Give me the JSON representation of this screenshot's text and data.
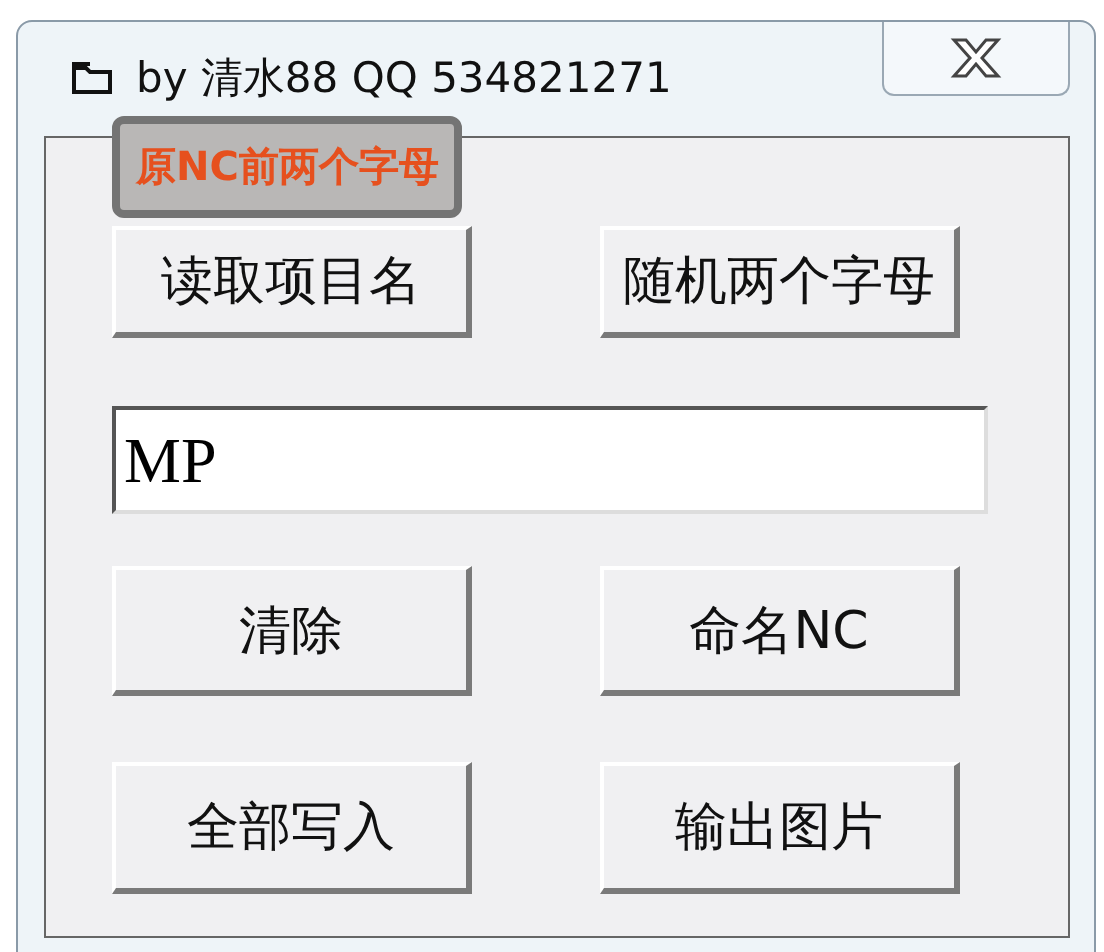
{
  "window": {
    "title": "by 清水88 QQ 534821271"
  },
  "tooltip": {
    "text": "原NC前两个字母"
  },
  "buttons_top": [
    "读取项目名",
    "随机两个字母"
  ],
  "name_field": {
    "value": "MP"
  },
  "buttons_bottom": [
    "清除",
    "命名NC",
    "全部写入",
    "输出图片"
  ]
}
